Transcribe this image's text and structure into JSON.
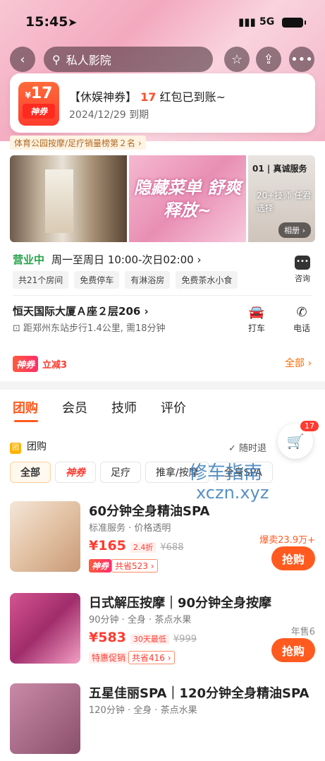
{
  "status": {
    "time": "15:45",
    "network": "5G"
  },
  "nav": {
    "search": "私人影院"
  },
  "coupon": {
    "amount": "17",
    "currency": "¥",
    "badge": "神券",
    "title_pre": "【休娱神券】",
    "title_num": "17",
    "title_post": "红包已到账~",
    "date": "2024/12/29 到期"
  },
  "rank": "体育公园按摩/足疗销量榜第２名 ›",
  "gallery": {
    "banner": "隐藏菜单 舒爽释放~",
    "card_head": "01 | 真诚服务",
    "card_text": "20+技师 任君选择",
    "album": "相册 ›"
  },
  "info": {
    "open": "营业中",
    "hours": "周一至周日 10:00-次日02:00",
    "consult": "咨询",
    "tags": [
      "共21个房间",
      "免费停车",
      "有淋浴房",
      "免费茶水小食"
    ],
    "address": "恒天国际大厦Ａ座２层206",
    "distance": "距郑州东站步行1.4公里, 需18分钟",
    "taxi": "打车",
    "phone": "电话"
  },
  "promo": {
    "badge": "神券",
    "text": "立减3",
    "all": "全部 ›"
  },
  "tabs": [
    "团购",
    "会员",
    "技师",
    "评价"
  ],
  "cart_count": "17",
  "group": {
    "title": "团购",
    "refund": "随时退"
  },
  "filters": [
    "全部",
    "神券",
    "足疗",
    "推拿/按摩",
    "全身SPA"
  ],
  "watermark": {
    "line1": "修车指南",
    "line2": "xczn.xyz"
  },
  "deals": [
    {
      "name": "60分钟全身精油SPA",
      "sub": "标准服务 · 价格透明",
      "price": "¥165",
      "discount": "2.4折",
      "orig": "¥688",
      "tag_a": "神券",
      "tag_b": "共省523 ›",
      "sold": "爆卖23.9万+",
      "buy": "抢购"
    },
    {
      "name": "日式解压按摩｜90分钟全身按摩",
      "sub": "90分钟 · 全身 · 茶点水果",
      "price": "¥583",
      "discount": "30天最低",
      "orig": "¥999",
      "tag_a": "特惠促销",
      "tag_b": "共省416 ›",
      "sold": "年售6",
      "buy": "抢购"
    },
    {
      "name": "五星佳丽SPA｜120分钟全身精油SPA",
      "sub": "120分钟 · 全身 · 茶点水果"
    }
  ],
  "colors": {
    "accent": "#ff5a1f",
    "price": "#ff3b30",
    "open": "#27a34a"
  }
}
